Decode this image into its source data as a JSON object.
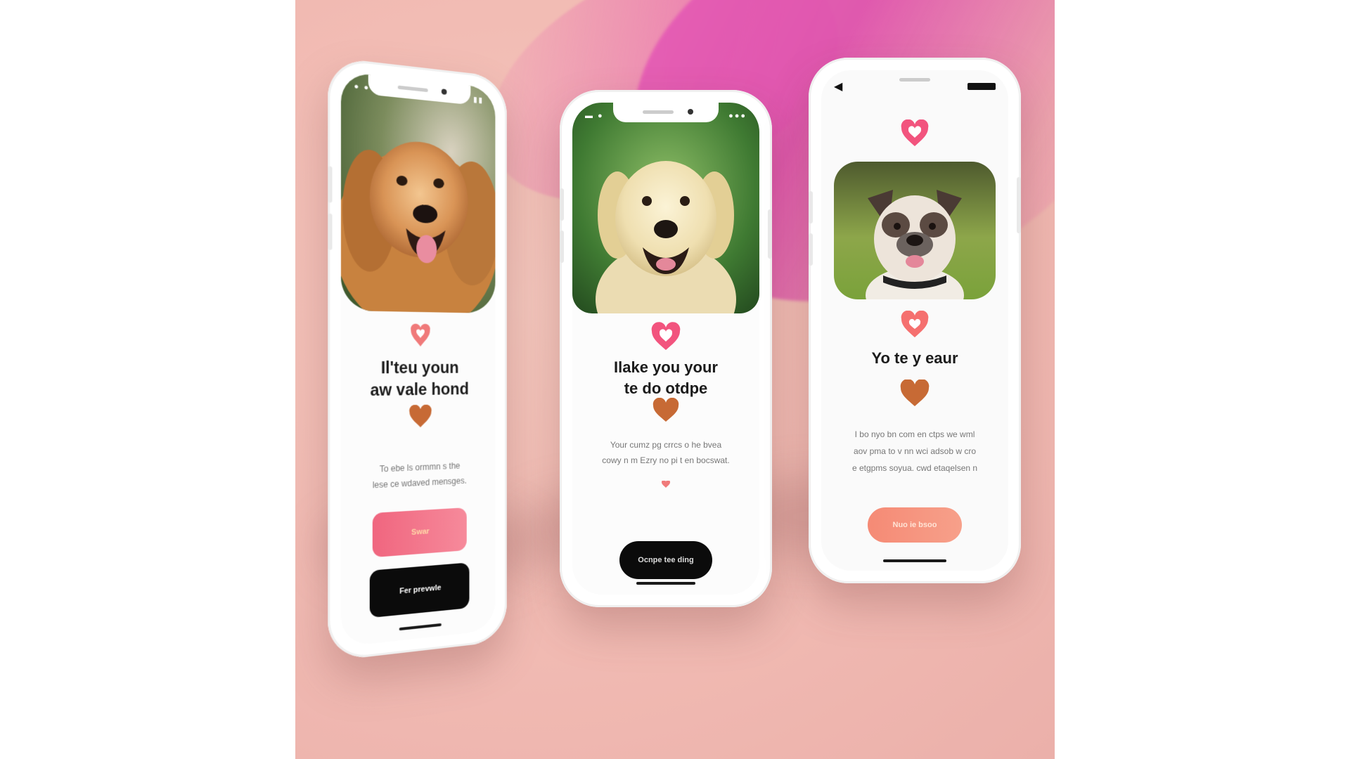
{
  "colors": {
    "accent_pink": "#f2547e",
    "accent_coral": "#f58a75",
    "brown_heart": "#c76a35",
    "dark_button": "#0b0b0b"
  },
  "phones": [
    {
      "title_line1": "Il'teu youn",
      "title_line2": "aw vale hond",
      "body_line1": "To ebe ls ormmn s the",
      "body_line2": "lese ce wdaved mensges.",
      "primary_button": "Swar",
      "secondary_button": "Fer prevwle"
    },
    {
      "title_line1": "Ilake you your",
      "title_line2": "te do otdpe",
      "body_line1": "Your cumz pg crrcs o he bvea",
      "body_line2": "cowy n m Ezry no pi t en bocswat.",
      "primary_button": "Ocnpe tee ding"
    },
    {
      "title_line1": "Yo te y eaur",
      "body_line1": "I bo nyo bn com en ctps we wml",
      "body_line2": "aov pma to v nn wci adsob w cro",
      "body_line3": "e etgpms soyua. cwd etaqelsen n",
      "primary_button": "Nuo ie bsoo"
    }
  ],
  "icons": {
    "heart": "heart-icon",
    "back": "back-arrow-icon",
    "battery": "battery-icon",
    "signal": "signal-dots-icon"
  }
}
